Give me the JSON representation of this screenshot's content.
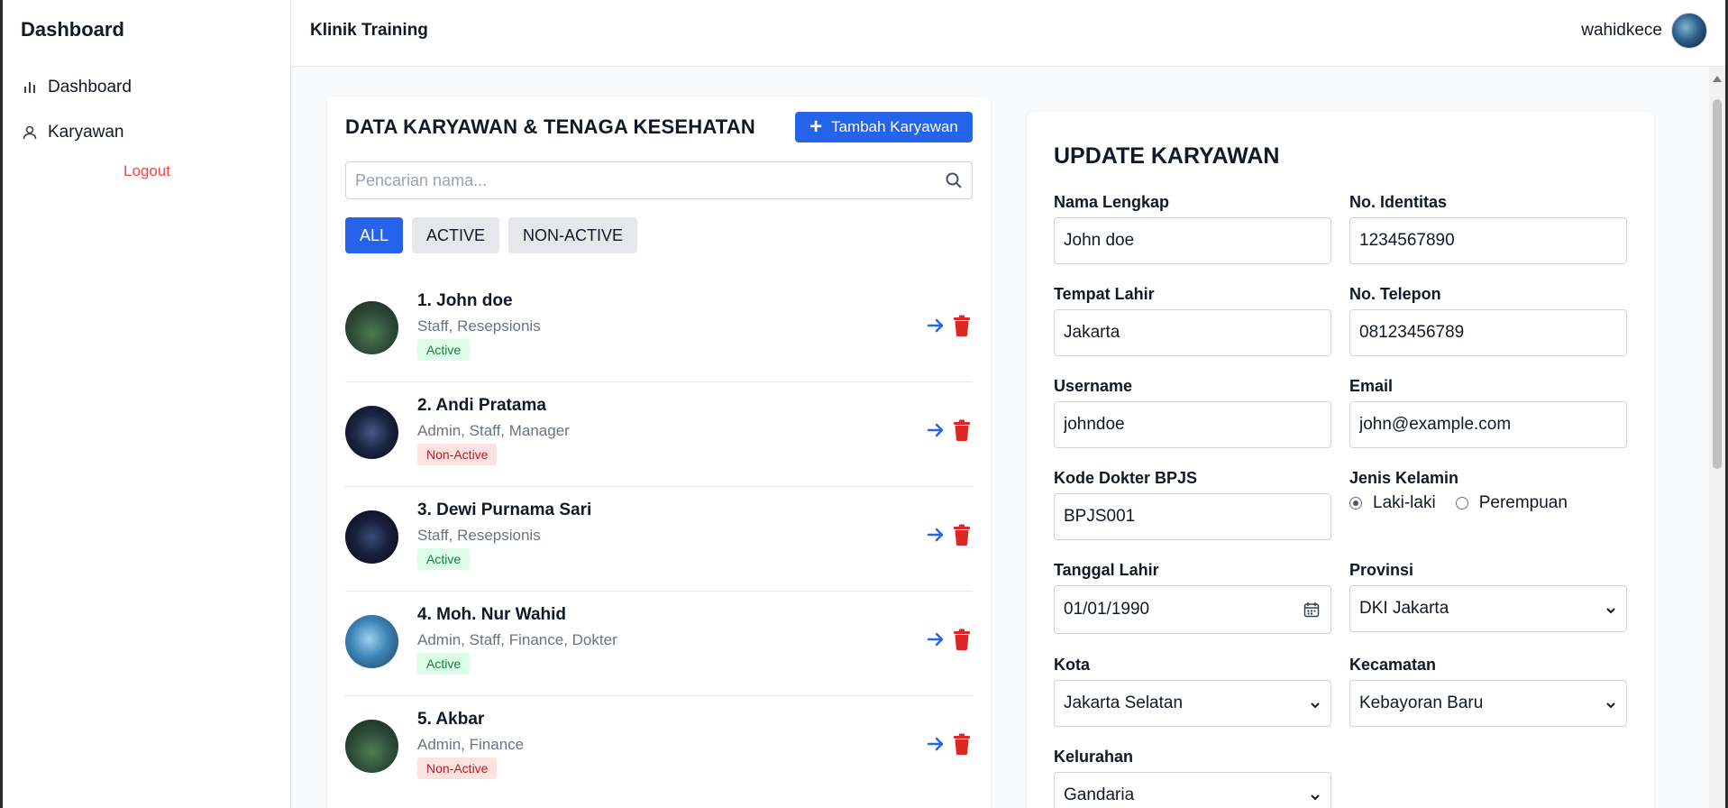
{
  "sidebar": {
    "brand": "Dashboard",
    "items": [
      {
        "label": "Dashboard",
        "icon": "bar-chart-icon"
      },
      {
        "label": "Karyawan",
        "icon": "user-icon"
      }
    ],
    "logout": "Logout"
  },
  "header": {
    "title": "Klinik Training",
    "username": "wahidkece"
  },
  "list": {
    "title": "DATA KARYAWAN & TENAGA KESEHATAN",
    "add_button": "Tambah Karyawan",
    "search_placeholder": "Pencarian nama...",
    "filters": [
      "ALL",
      "ACTIVE",
      "NON-ACTIVE"
    ],
    "employees": [
      {
        "name": "1. John doe",
        "roles": "Staff, Resepsionis",
        "status": "Active"
      },
      {
        "name": "2. Andi Pratama",
        "roles": "Admin, Staff, Manager",
        "status": "Non-Active"
      },
      {
        "name": "3. Dewi Purnama Sari",
        "roles": "Staff, Resepsionis",
        "status": "Active"
      },
      {
        "name": "4. Moh. Nur Wahid",
        "roles": "Admin, Staff, Finance, Dokter",
        "status": "Active"
      },
      {
        "name": "5. Akbar",
        "roles": "Admin, Finance",
        "status": "Non-Active"
      }
    ]
  },
  "form": {
    "title": "UPDATE KARYAWAN",
    "nama_lengkap": {
      "label": "Nama Lengkap",
      "value": "John doe"
    },
    "no_identitas": {
      "label": "No. Identitas",
      "value": "1234567890"
    },
    "tempat_lahir": {
      "label": "Tempat Lahir",
      "value": "Jakarta"
    },
    "no_telepon": {
      "label": "No. Telepon",
      "value": "08123456789"
    },
    "username": {
      "label": "Username",
      "value": "johndoe"
    },
    "email": {
      "label": "Email",
      "value": "john@example.com"
    },
    "kode_dokter": {
      "label": "Kode Dokter BPJS",
      "value": "BPJS001"
    },
    "jenis_kelamin": {
      "label": "Jenis Kelamin",
      "options": [
        "Laki-laki",
        "Perempuan"
      ],
      "selected": "Laki-laki"
    },
    "tanggal_lahir": {
      "label": "Tanggal Lahir",
      "value": "01/01/1990"
    },
    "provinsi": {
      "label": "Provinsi",
      "value": "DKI Jakarta"
    },
    "kota": {
      "label": "Kota",
      "value": "Jakarta Selatan"
    },
    "kecamatan": {
      "label": "Kecamatan",
      "value": "Kebayoran Baru"
    },
    "kelurahan": {
      "label": "Kelurahan",
      "value": "Gandaria"
    }
  },
  "colors": {
    "primary": "#2563eb",
    "danger": "#dc2626",
    "active_bg": "#dcfce7",
    "inactive_bg": "#fee2e2"
  }
}
